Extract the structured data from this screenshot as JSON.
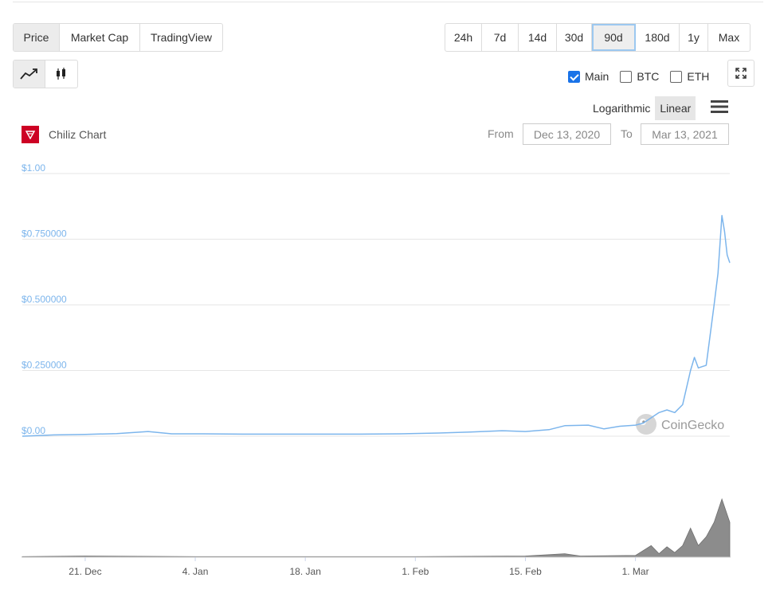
{
  "view_tabs": [
    "Price",
    "Market Cap",
    "TradingView"
  ],
  "view_tabs_active": 0,
  "range_tabs": [
    "24h",
    "7d",
    "14d",
    "30d",
    "90d",
    "180d",
    "1y",
    "Max"
  ],
  "range_tabs_active": 4,
  "chart_type_toggle": {
    "line_icon": "line-chart-icon",
    "candle_icon": "candlestick-icon",
    "active": "line"
  },
  "series_toggles": [
    {
      "label": "Main",
      "checked": true
    },
    {
      "label": "BTC",
      "checked": false
    },
    {
      "label": "ETH",
      "checked": false
    }
  ],
  "scale": {
    "log_label": "Logarithmic",
    "linear_label": "Linear",
    "active": "Linear"
  },
  "menu_icon": "hamburger-menu-icon",
  "expand_icon": "expand-icon",
  "chart_title": "Chiliz Chart",
  "logo_icon": "chiliz-logo-icon",
  "date_range": {
    "from_label": "From",
    "from_value": "Dec 13, 2020",
    "to_label": "To",
    "to_value": "Mar 13, 2021"
  },
  "watermark": "CoinGecko",
  "colors": {
    "line": "#7cb5ec",
    "axis_label": "#7cb5ec",
    "volume": "#8c8c8c",
    "gridline": "#e6e6e6",
    "logo": "#cd0124",
    "active_outline": "#9cc8f0"
  },
  "chart_data": {
    "type": "line",
    "title": "",
    "ylabel": "",
    "ylim": [
      0,
      1
    ],
    "y_ticks": [
      {
        "value": 1.0,
        "label": "$1.00"
      },
      {
        "value": 0.75,
        "label": "$0.750000"
      },
      {
        "value": 0.5,
        "label": "$0.500000"
      },
      {
        "value": 0.25,
        "label": "$0.250000"
      },
      {
        "value": 0.0,
        "label": "$0.00"
      }
    ],
    "x_range": [
      "2020-12-13",
      "2021-03-13"
    ],
    "x_ticks": [
      {
        "date": "2020-12-21",
        "label": "21. Dec"
      },
      {
        "date": "2021-01-04",
        "label": "4. Jan"
      },
      {
        "date": "2021-01-18",
        "label": "18. Jan"
      },
      {
        "date": "2021-02-01",
        "label": "1. Feb"
      },
      {
        "date": "2021-02-15",
        "label": "15. Feb"
      },
      {
        "date": "2021-03-01",
        "label": "1. Mar"
      }
    ],
    "grid": true,
    "legend": "none",
    "series": [
      {
        "points": [
          [
            "2020-12-13",
            0.0
          ],
          [
            "2020-12-17",
            0.005
          ],
          [
            "2020-12-21",
            0.007
          ],
          [
            "2020-12-25",
            0.01
          ],
          [
            "2020-12-29",
            0.018
          ],
          [
            "2021-01-01",
            0.009
          ],
          [
            "2021-01-05",
            0.009
          ],
          [
            "2021-01-10",
            0.008
          ],
          [
            "2021-01-15",
            0.008
          ],
          [
            "2021-01-20",
            0.008
          ],
          [
            "2021-01-25",
            0.008
          ],
          [
            "2021-01-30",
            0.009
          ],
          [
            "2021-02-04",
            0.012
          ],
          [
            "2021-02-08",
            0.016
          ],
          [
            "2021-02-12",
            0.021
          ],
          [
            "2021-02-15",
            0.018
          ],
          [
            "2021-02-18",
            0.025
          ],
          [
            "2021-02-20",
            0.04
          ],
          [
            "2021-02-23",
            0.042
          ],
          [
            "2021-02-25",
            0.028
          ],
          [
            "2021-02-27",
            0.038
          ],
          [
            "2021-03-01",
            0.042
          ],
          [
            "2021-03-02",
            0.05
          ],
          [
            "2021-03-03",
            0.07
          ],
          [
            "2021-03-04",
            0.09
          ],
          [
            "2021-03-05",
            0.1
          ],
          [
            "2021-03-06",
            0.09
          ],
          [
            "2021-03-07",
            0.12
          ],
          [
            "2021-03-08",
            0.25
          ],
          [
            "2021-03-08T12:00",
            0.3
          ],
          [
            "2021-03-09",
            0.26
          ],
          [
            "2021-03-10",
            0.27
          ],
          [
            "2021-03-11",
            0.5
          ],
          [
            "2021-03-11T12:00",
            0.62
          ],
          [
            "2021-03-12",
            0.84
          ],
          [
            "2021-03-12T08:00",
            0.78
          ],
          [
            "2021-03-12T16:00",
            0.69
          ],
          [
            "2021-03-13",
            0.66
          ]
        ]
      }
    ],
    "volume": {
      "points": [
        [
          "2020-12-13",
          0.01
        ],
        [
          "2020-12-21",
          0.02
        ],
        [
          "2021-01-04",
          0.01
        ],
        [
          "2021-01-18",
          0.01
        ],
        [
          "2021-02-01",
          0.01
        ],
        [
          "2021-02-15",
          0.02
        ],
        [
          "2021-02-20",
          0.06
        ],
        [
          "2021-02-22",
          0.02
        ],
        [
          "2021-03-01",
          0.03
        ],
        [
          "2021-03-03",
          0.2
        ],
        [
          "2021-03-04",
          0.06
        ],
        [
          "2021-03-05",
          0.18
        ],
        [
          "2021-03-06",
          0.08
        ],
        [
          "2021-03-07",
          0.2
        ],
        [
          "2021-03-08",
          0.5
        ],
        [
          "2021-03-09",
          0.2
        ],
        [
          "2021-03-10",
          0.35
        ],
        [
          "2021-03-11",
          0.6
        ],
        [
          "2021-03-12",
          1.0
        ],
        [
          "2021-03-13",
          0.6
        ]
      ]
    }
  }
}
